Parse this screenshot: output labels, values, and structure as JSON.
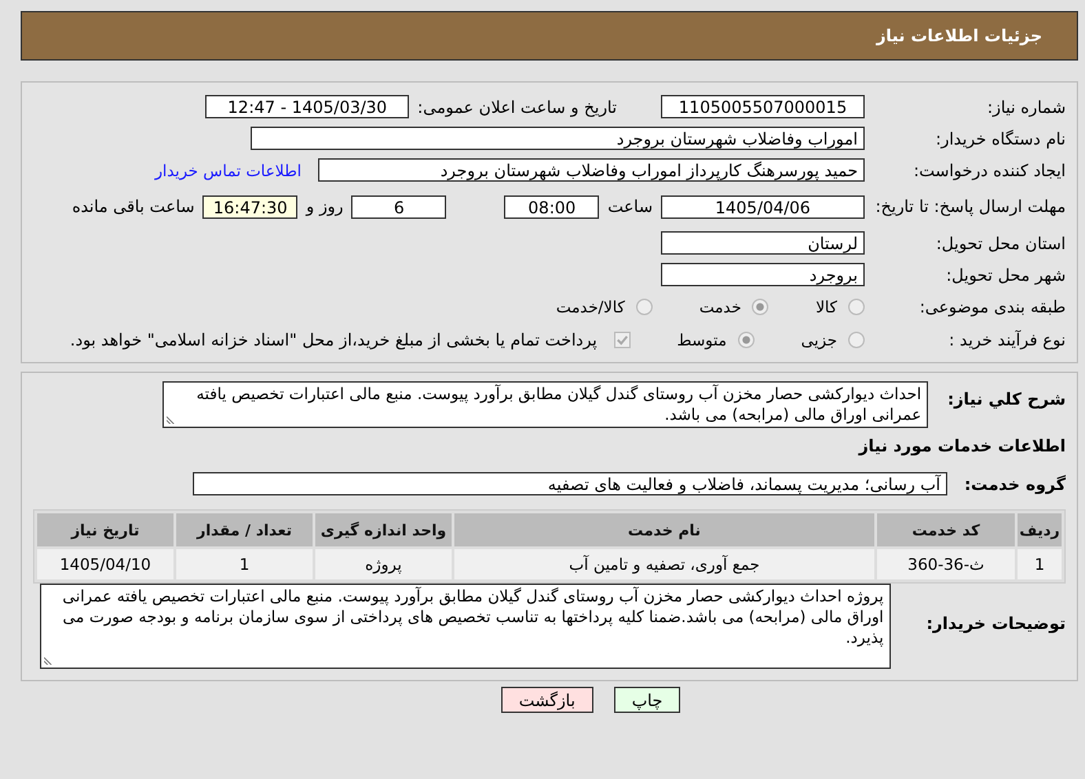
{
  "header": {
    "title": "جزئیات اطلاعات نیاز"
  },
  "details": {
    "need_number": {
      "label": "شماره نیاز:",
      "value": "1105005507000015"
    },
    "announce_date": {
      "label": "تاریخ و ساعت اعلان عمومی:",
      "value": "1405/03/30 - 12:47"
    },
    "buyer_org": {
      "label": "نام دستگاه خریدار:",
      "value": "اموراب وفاضلاب شهرستان بروجرد"
    },
    "requester": {
      "label": "ایجاد کننده درخواست:",
      "value": "حمید پورسرهنگ کارپرداز اموراب وفاضلاب شهرستان بروجرد",
      "link": "اطلاعات تماس خریدار"
    },
    "deadline": {
      "label": "مهلت ارسال پاسخ: تا تاریخ:",
      "date": "1405/04/06",
      "time_label": "ساعت",
      "time": "08:00",
      "days": "6",
      "days_label": "روز و",
      "remaining": "16:47:30",
      "remaining_label": "ساعت باقی مانده"
    },
    "province": {
      "label": "استان محل تحویل:",
      "value": "لرستان"
    },
    "city": {
      "label": "شهر محل تحویل:",
      "value": "بروجرد"
    },
    "category": {
      "label": "طبقه بندی موضوعی:",
      "options": [
        {
          "label": "کالا",
          "selected": false
        },
        {
          "label": "خدمت",
          "selected": true
        },
        {
          "label": "کالا/خدمت",
          "selected": false
        }
      ]
    },
    "purchase_type": {
      "label": "نوع فرآیند خرید :",
      "options": [
        {
          "label": "جزیی",
          "selected": false
        },
        {
          "label": "متوسط",
          "selected": true
        }
      ],
      "payment": {
        "label": "پرداخت تمام یا بخشی از مبلغ خرید،از محل \"اسناد خزانه اسلامی\" خواهد بود.",
        "checked": true,
        "disabled": true
      }
    }
  },
  "summary": {
    "label": "شرح کلي نیاز:",
    "value": "احداث دیوارکشی حصار مخزن آب روستای گندل گیلان مطابق برآورد پیوست. منبع مالی اعتبارات تخصیص یافته عمرانی اوراق مالی (مرابحه) می باشد."
  },
  "services_heading": "اطلاعات خدمات مورد نیاز",
  "service_group": {
    "label": "گروه خدمت:",
    "value": "آب رسانی؛ مدیریت پسماند، فاضلاب و فعالیت های تصفیه"
  },
  "table": {
    "columns": [
      "ردیف",
      "کد خدمت",
      "نام خدمت",
      "واحد اندازه گیری",
      "تعداد / مقدار",
      "تاریخ نیاز"
    ],
    "rows": [
      [
        "1",
        "ث-36-360",
        "جمع آوری، تصفیه و تامین آب",
        "پروژه",
        "1",
        "1405/04/10"
      ]
    ]
  },
  "buyer_notes": {
    "label": "توضیحات خریدار:",
    "value": "پروژه احداث دیوارکشی حصار مخزن آب روستای گندل گیلان مطابق برآورد پیوست. منبع مالی اعتبارات تخصیص یافته عمرانی اوراق مالی (مرابحه) می باشد.ضمنا کلیه پرداختها به تناسب تخصیص های پرداختی از سوی سازمان برنامه و بودجه صورت می پذیرد."
  },
  "buttons": [
    {
      "label": "چاپ",
      "kind": "print"
    },
    {
      "label": "بازگشت",
      "kind": "back"
    }
  ]
}
